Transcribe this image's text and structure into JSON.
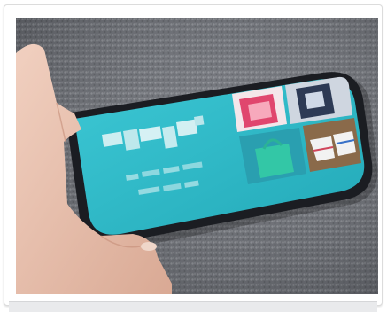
{
  "image": {
    "subject": "hand-holding-smartphone",
    "scene": "phone-on-grey-knit-fabric",
    "colors": {
      "fabric": "#6d7077",
      "fabric_light": "#9a9da3",
      "screen_teal": "#2fb8c6",
      "phone_body": "#1b1d22",
      "skin": "#e8c3b0",
      "bag_green": "#33c7a6",
      "shoe_white": "#f2f2f2",
      "pink_item": "#e0466e"
    }
  }
}
